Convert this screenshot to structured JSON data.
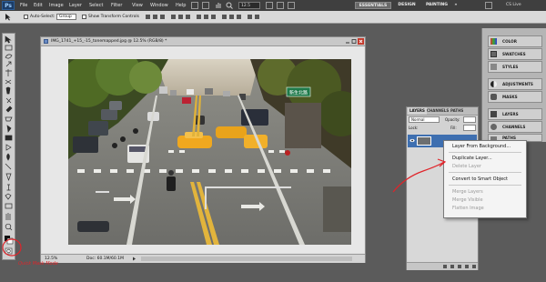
{
  "app": {
    "logo": "Ps",
    "menu": [
      "File",
      "Edit",
      "Image",
      "Layer",
      "Select",
      "Filter",
      "View",
      "Window",
      "Help"
    ],
    "zoom": "12.5",
    "workspaces": [
      "ESSENTIALS",
      "DESIGN",
      "PAINTING",
      "»"
    ],
    "cs_live": "CS Live"
  },
  "options_bar": {
    "auto_select_label": "Auto-Select:",
    "auto_select_value": "Group",
    "transform_label": "Show Transform Controls"
  },
  "document": {
    "title": "IMG_1741_+15_-15_tonemapped.jpg @ 12.5% (RGB/8) *",
    "zoom": "12.5%",
    "doc_info": "Doc: 60.1M/60.1M",
    "photo_sign": "新生北路"
  },
  "dock": {
    "items": [
      "COLOR",
      "SWATCHES",
      "STYLES",
      "ADJUSTMENTS",
      "MASKS",
      "LAYERS",
      "CHANNELS",
      "PATHS"
    ]
  },
  "layers_panel": {
    "tabs": [
      "LAYERS",
      "CHANNELS",
      "PATHS"
    ],
    "blend_mode": "Normal",
    "opacity_label": "Opacity:",
    "lock_label": "Lock:",
    "fill_label": "Fill:"
  },
  "context_menu": {
    "items": [
      "Layer From Background...",
      "Duplicate Layer...",
      "Delete Layer",
      "Convert to Smart Object",
      "Merge Layers",
      "Merge Visible",
      "Flatten Image"
    ]
  },
  "annotation": {
    "label": "Quick Mask Mode"
  },
  "colors": {
    "annotation": "#e0242a",
    "accent": "#4a6f9c"
  }
}
